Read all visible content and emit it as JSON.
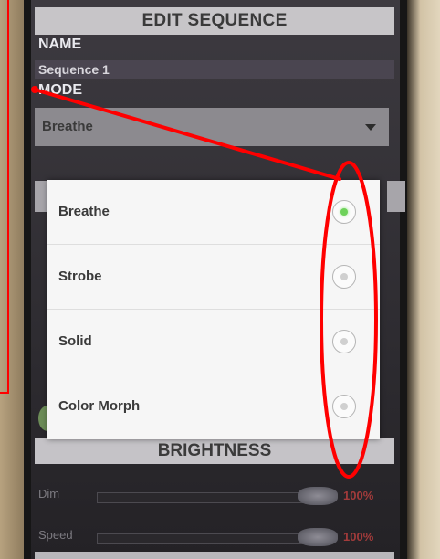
{
  "header": {
    "title": "EDIT SEQUENCE"
  },
  "name_section": {
    "label": "NAME",
    "value": "Sequence 1"
  },
  "mode_section": {
    "label": "MODE",
    "selected": "Breathe",
    "dropdown_icon": "triangle-down-icon"
  },
  "dialog": {
    "options": [
      {
        "label": "Breathe",
        "selected": true
      },
      {
        "label": "Strobe",
        "selected": false
      },
      {
        "label": "Solid",
        "selected": false
      },
      {
        "label": "Color Morph",
        "selected": false
      }
    ]
  },
  "brightness_section": {
    "title": "BRIGHTNESS"
  },
  "sliders": [
    {
      "label": "Dim",
      "value_text": "100%",
      "level": 1.0
    },
    {
      "label": "Speed",
      "value_text": "100%",
      "level": 1.0
    }
  ],
  "colors": {
    "selected_radio": "#6ed25a",
    "annotation": "#ff0000",
    "percent_text": "#a23b3b"
  }
}
